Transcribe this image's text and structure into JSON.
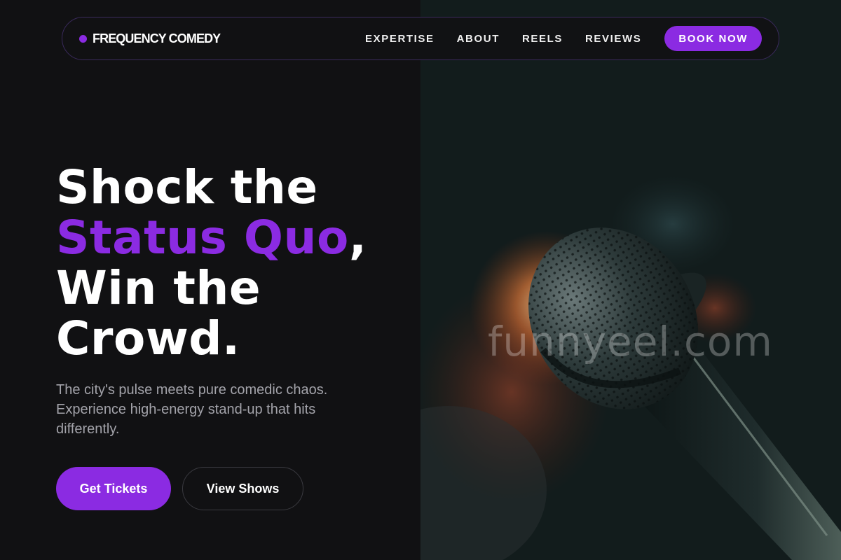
{
  "nav": {
    "logo_text": "FREQUENCY COMEDY",
    "links": [
      "EXPERTISE",
      "ABOUT",
      "REELS",
      "REVIEWS"
    ],
    "cta": "BOOK NOW"
  },
  "hero": {
    "headline_line1": "Shock the",
    "headline_accent": "Status Quo",
    "headline_comma": ",",
    "headline_line3": "Win the",
    "headline_line4": "Crowd.",
    "subtitle": "The city's pulse meets pure comedic chaos. Experience high-energy stand-up that hits differently.",
    "primary_button": "Get Tickets",
    "secondary_button": "View Shows",
    "image_watermark": "funnyeel.com"
  },
  "colors": {
    "accent": "#8b2be2",
    "background": "#111113",
    "muted_text": "#a3a3aa"
  },
  "icons": {
    "logo_mark": "purple-dot-icon",
    "hero_image": "microphone"
  }
}
